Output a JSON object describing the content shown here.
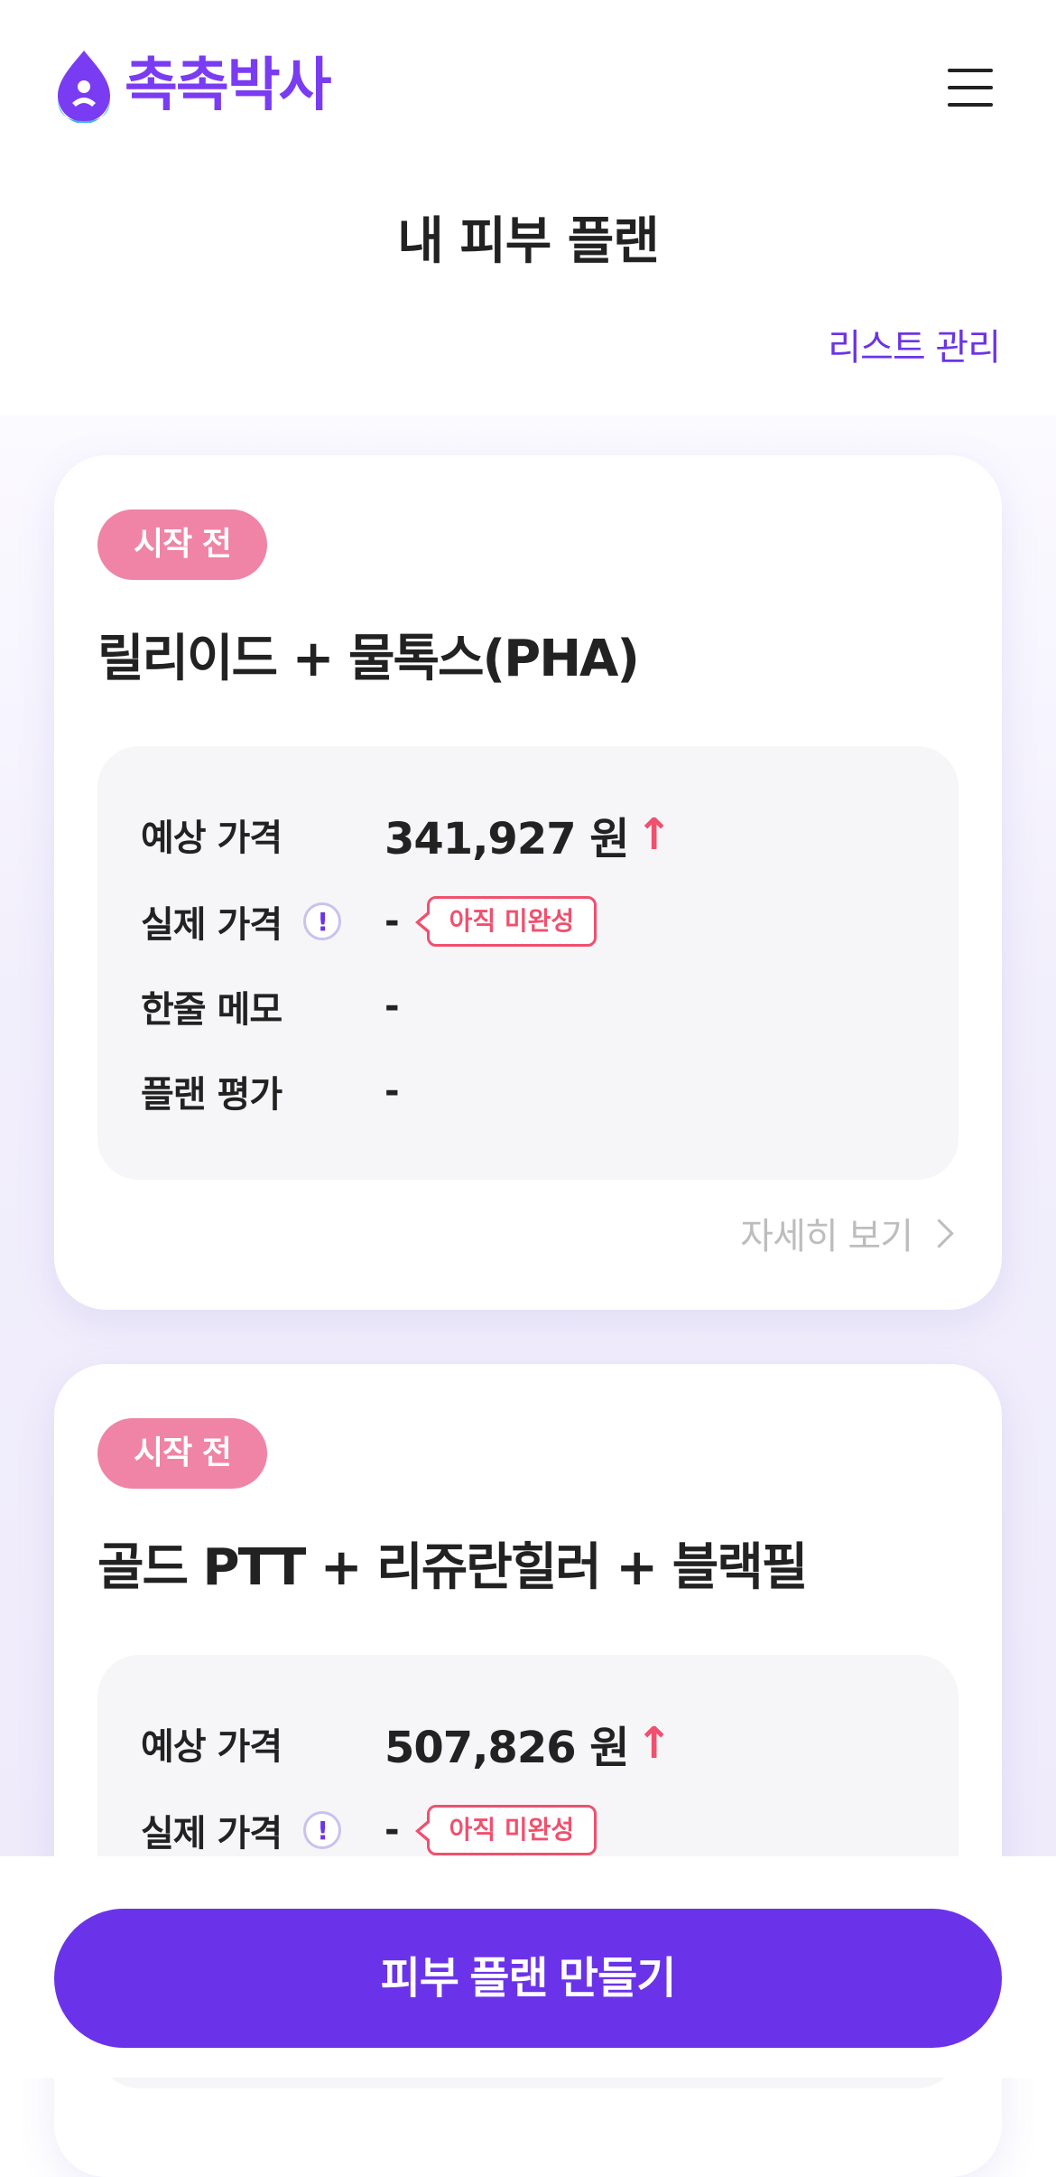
{
  "header": {
    "logo_text": "촉촉박사",
    "menu_icon": "hamburger-menu-icon"
  },
  "page": {
    "title": "내 피부 플랜",
    "list_manage": "리스트 관리"
  },
  "labels": {
    "expected_price": "예상 가격",
    "actual_price": "실제 가격",
    "memo": "한줄 메모",
    "rating": "플랜 평가",
    "details": "자세히 보기",
    "incomplete": "아직 미완성",
    "up_arrow": "↑",
    "info_mark": "!"
  },
  "plans": [
    {
      "status": "시작 전",
      "title": "릴리이드 + 물톡스(PHA)",
      "expected_price": "341,927 원",
      "actual_price": "-",
      "memo": "-",
      "rating": "-"
    },
    {
      "status": "시작 전",
      "title": "골드 PTT + 리쥬란힐러 + 블랙필",
      "expected_price": "507,826 원",
      "actual_price": "-"
    }
  ],
  "cta": {
    "label": "피부 플랜 만들기"
  },
  "colors": {
    "brand": "#6a33ea",
    "status_badge": "#ef84a6",
    "warning": "#f0506e",
    "logo_drop_top": "#7a3cf2",
    "logo_drop_bottom": "#3fb6f0"
  }
}
